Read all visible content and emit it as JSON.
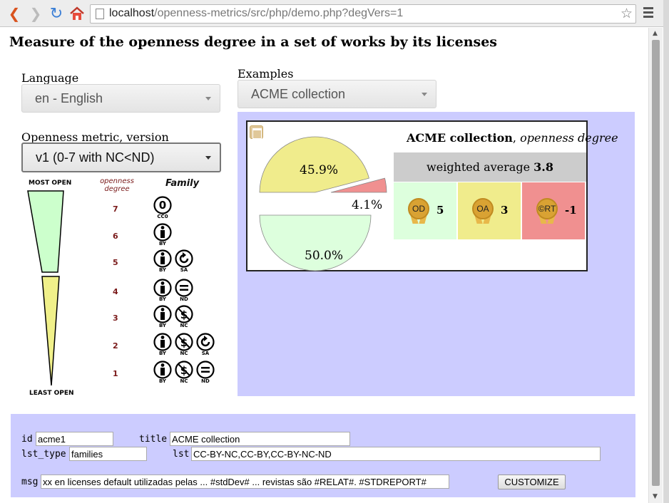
{
  "browser": {
    "url_host": "localhost",
    "url_path": "/openness-metrics/src/php/demo.php?degVers=1"
  },
  "page_title": "Measure of the openness degree in a set of works by its licenses",
  "language": {
    "label": "Language",
    "value": "en - English"
  },
  "examples": {
    "label": "Examples",
    "value": "ACME collection"
  },
  "metric": {
    "label": "Openness metric, version",
    "value": "v1 (0-7 with NC<ND)"
  },
  "scale": {
    "most_open": "MOST OPEN",
    "least_open": "LEAST OPEN",
    "openness_degree_label": "openness degree",
    "family_label": "Family",
    "rows": [
      {
        "degree": "7",
        "licenses": [
          "CC0"
        ]
      },
      {
        "degree": "6",
        "licenses": [
          "BY"
        ]
      },
      {
        "degree": "5",
        "licenses": [
          "BY",
          "SA"
        ]
      },
      {
        "degree": "4",
        "licenses": [
          "BY",
          "ND"
        ]
      },
      {
        "degree": "3",
        "licenses": [
          "BY",
          "NC"
        ]
      },
      {
        "degree": "2",
        "licenses": [
          "BY",
          "NC",
          "SA"
        ]
      },
      {
        "degree": "1",
        "licenses": [
          "BY",
          "NC",
          "ND"
        ]
      }
    ],
    "colors": {
      "top_wedge": "#ccffcc",
      "bottom_wedge": "#f0f08a",
      "degree_num": "#7a1a1a"
    }
  },
  "result": {
    "title_name": "ACME collection",
    "title_sep": ", ",
    "title_suffix": "openness degree",
    "weighted_average_label": "weighted average ",
    "weighted_average_value": "3.8",
    "pie": {
      "slices": [
        {
          "label": "45.9%",
          "value": 45.9,
          "color": "#f0ec8c"
        },
        {
          "label": "4.1%",
          "value": 4.1,
          "color": "#f09090"
        },
        {
          "label": "50.0%",
          "value": 50.0,
          "color": "#ddffdd"
        }
      ]
    },
    "seals": [
      {
        "name": "OD",
        "count": "5",
        "bg": "#ddffdd"
      },
      {
        "name": "OA",
        "count": "3",
        "bg": "#f0ec8c"
      },
      {
        "name": "©RT",
        "count": "-1",
        "bg": "#f09090"
      }
    ],
    "panel_color": "#ccccff"
  },
  "form": {
    "id_label": "id",
    "id_value": "acme1",
    "title_label": "title",
    "title_value": "ACME collection",
    "lst_type_label": "lst_type",
    "lst_type_value": "families",
    "lst_label": "lst",
    "lst_value": "CC-BY-NC,CC-BY,CC-BY-NC-ND",
    "msg_label": "msg",
    "msg_value": "xx en licenses default utilizadas pelas ... #stdDev# ... revistas são #RELAT#. #STDREPORT#",
    "button_label": "CUSTOMIZE"
  }
}
